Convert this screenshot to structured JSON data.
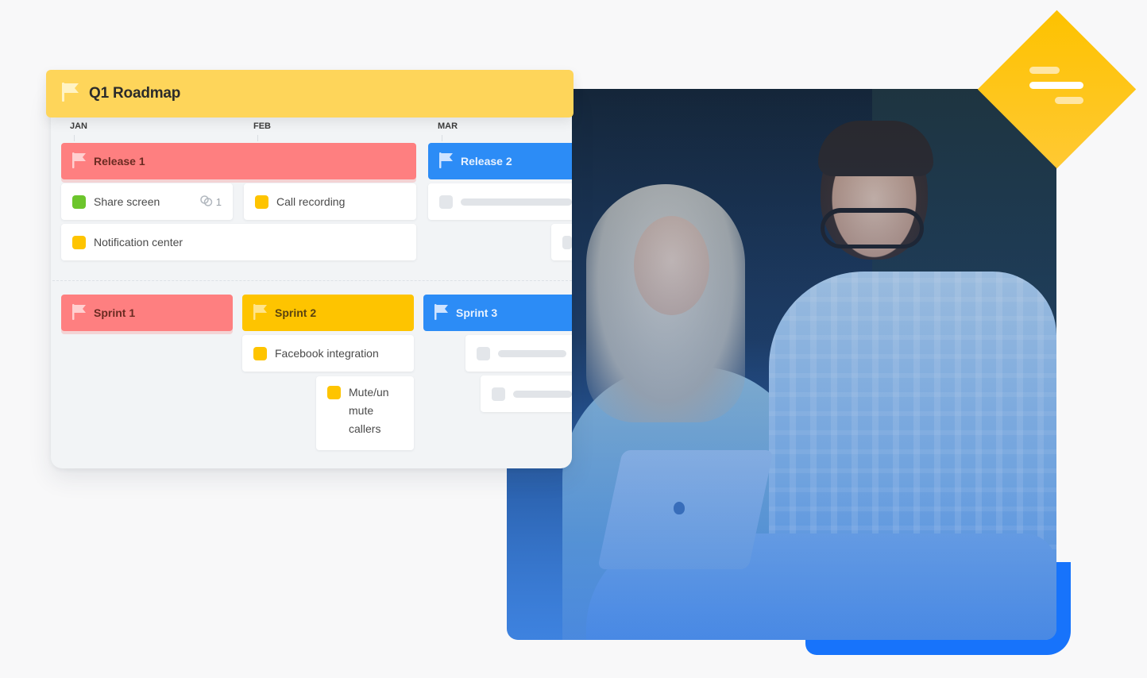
{
  "roadmap": {
    "title": "Q1 Roadmap",
    "header_icon": "flag-icon",
    "months": [
      "JAN",
      "FEB",
      "MAR"
    ],
    "releases": [
      {
        "label": "Release 1",
        "color": "#fe7f80",
        "icon": "flag-icon",
        "items": [
          {
            "label": "Share screen",
            "status_color": "#6cc52c",
            "linked_count": "1",
            "link_icon": "link-icon"
          },
          {
            "label": "Call recording",
            "status_color": "#fec400"
          },
          {
            "label": "Notification center",
            "status_color": "#fec400"
          }
        ]
      },
      {
        "label": "Release 2",
        "color": "#2c8cf6",
        "icon": "flag-icon",
        "items": [
          {
            "label": "",
            "placeholder": true
          },
          {
            "label": "",
            "placeholder": true
          }
        ]
      }
    ],
    "sprints": [
      {
        "label": "Sprint 1",
        "color": "#fe7f80",
        "icon": "flag-icon",
        "items": []
      },
      {
        "label": "Sprint 2",
        "color": "#fec400",
        "icon": "flag-icon",
        "items": [
          {
            "label": "Facebook integration",
            "status_color": "#fec400"
          },
          {
            "label_lines": [
              "Mute/un",
              "mute",
              "callers"
            ],
            "status_color": "#fec400"
          }
        ]
      },
      {
        "label": "Sprint 3",
        "color": "#2c8cf6",
        "icon": "flag-icon",
        "items": [
          {
            "label": "",
            "placeholder": true
          },
          {
            "label": "",
            "placeholder": true
          }
        ]
      }
    ]
  },
  "logo": {
    "icon": "roadmap-bars-logo-icon",
    "color": "#fdc200"
  },
  "photo": {
    "description": "Two people smiling and looking at a laptop",
    "accent_color": "#1773fb"
  }
}
